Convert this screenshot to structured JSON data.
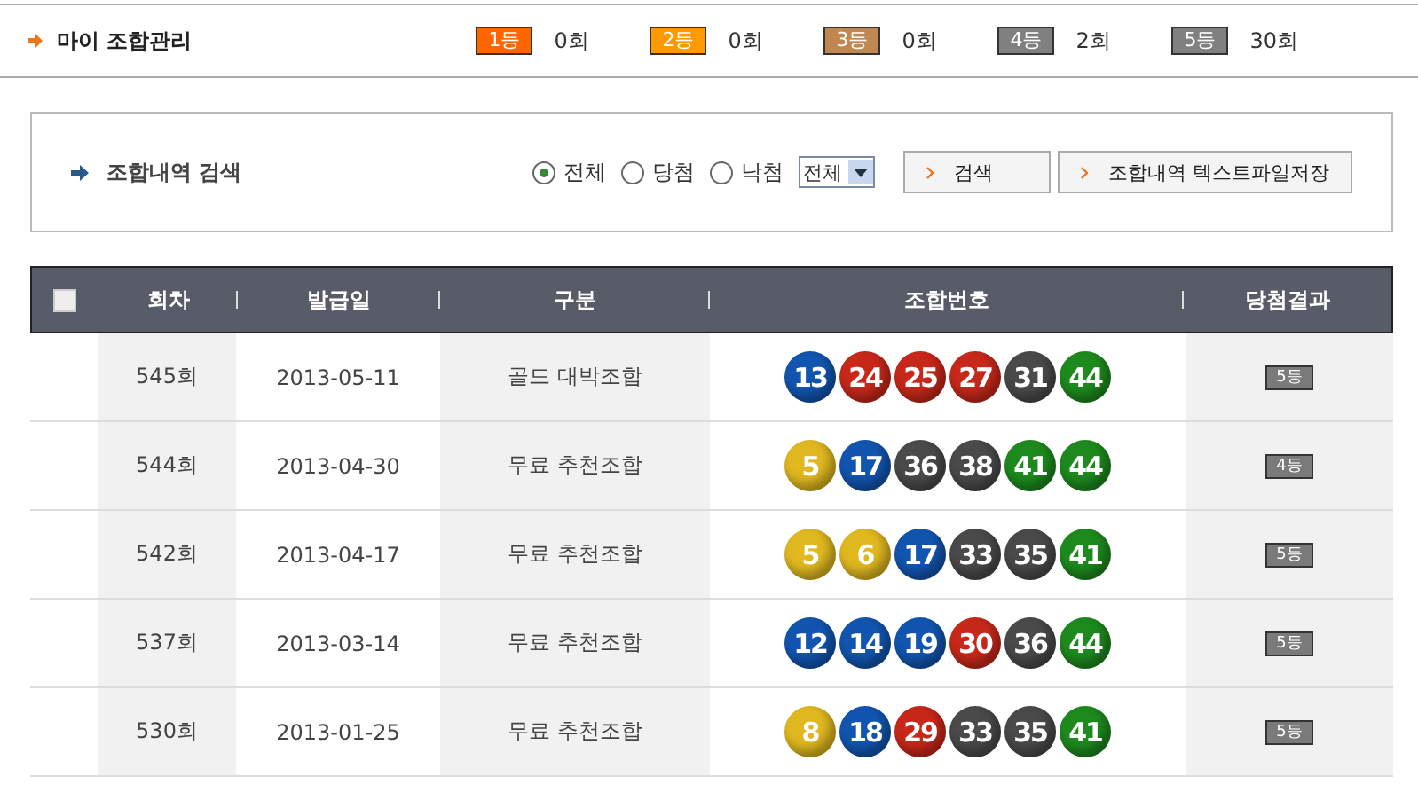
{
  "header": {
    "title": "마이 조합관리",
    "ranks": [
      {
        "label": "1등",
        "count": "0회",
        "color": "#ff6600"
      },
      {
        "label": "2등",
        "count": "0회",
        "color": "#ff9900"
      },
      {
        "label": "3등",
        "count": "0회",
        "color": "#c08850"
      },
      {
        "label": "4등",
        "count": "2회",
        "color": "#808080"
      },
      {
        "label": "5등",
        "count": "30회",
        "color": "#808080"
      }
    ]
  },
  "search": {
    "title": "조합내역 검색",
    "filters": [
      {
        "label": "전체",
        "selected": true
      },
      {
        "label": "당첨",
        "selected": false
      },
      {
        "label": "낙첨",
        "selected": false
      }
    ],
    "select": "전체",
    "buttons": [
      "검색",
      "조합내역 텍스트파일저장"
    ]
  },
  "table": {
    "select_all": {
      "checked": false
    },
    "columns": [
      "회차",
      "발급일",
      "구분",
      "조합번호",
      "당첨결과"
    ],
    "rows": [
      {
        "round": "545회",
        "date": "2013-05-11",
        "type": "골드 대박조합",
        "result": "5등",
        "balls": [
          {
            "n": "13",
            "color": "#1255b0"
          },
          {
            "n": "24",
            "color": "#c8281a"
          },
          {
            "n": "25",
            "color": "#c8281a"
          },
          {
            "n": "27",
            "color": "#c8281a"
          },
          {
            "n": "31",
            "color": "#4a4a4a"
          },
          {
            "n": "44",
            "color": "#1e8a1e"
          }
        ]
      },
      {
        "round": "544회",
        "date": "2013-04-30",
        "type": "무료 추천조합",
        "result": "4등",
        "balls": [
          {
            "n": "5",
            "color": "#e0b820"
          },
          {
            "n": "17",
            "color": "#1255b0"
          },
          {
            "n": "36",
            "color": "#4a4a4a"
          },
          {
            "n": "38",
            "color": "#4a4a4a"
          },
          {
            "n": "41",
            "color": "#1e8a1e"
          },
          {
            "n": "44",
            "color": "#1e8a1e"
          }
        ]
      },
      {
        "round": "542회",
        "date": "2013-04-17",
        "type": "무료 추천조합",
        "result": "5등",
        "balls": [
          {
            "n": "5",
            "color": "#e0b820"
          },
          {
            "n": "6",
            "color": "#e0b820"
          },
          {
            "n": "17",
            "color": "#1255b0"
          },
          {
            "n": "33",
            "color": "#4a4a4a"
          },
          {
            "n": "35",
            "color": "#4a4a4a"
          },
          {
            "n": "41",
            "color": "#1e8a1e"
          }
        ]
      },
      {
        "round": "537회",
        "date": "2013-03-14",
        "type": "무료 추천조합",
        "result": "5등",
        "balls": [
          {
            "n": "12",
            "color": "#1255b0"
          },
          {
            "n": "14",
            "color": "#1255b0"
          },
          {
            "n": "19",
            "color": "#1255b0"
          },
          {
            "n": "30",
            "color": "#c8281a"
          },
          {
            "n": "36",
            "color": "#4a4a4a"
          },
          {
            "n": "44",
            "color": "#1e8a1e"
          }
        ]
      },
      {
        "round": "530회",
        "date": "2013-01-25",
        "type": "무료 추천조합",
        "result": "5등",
        "balls": [
          {
            "n": "8",
            "color": "#e0b820"
          },
          {
            "n": "18",
            "color": "#1255b0"
          },
          {
            "n": "29",
            "color": "#c8281a"
          },
          {
            "n": "33",
            "color": "#4a4a4a"
          },
          {
            "n": "35",
            "color": "#4a4a4a"
          },
          {
            "n": "41",
            "color": "#1e8a1e"
          }
        ]
      }
    ]
  }
}
